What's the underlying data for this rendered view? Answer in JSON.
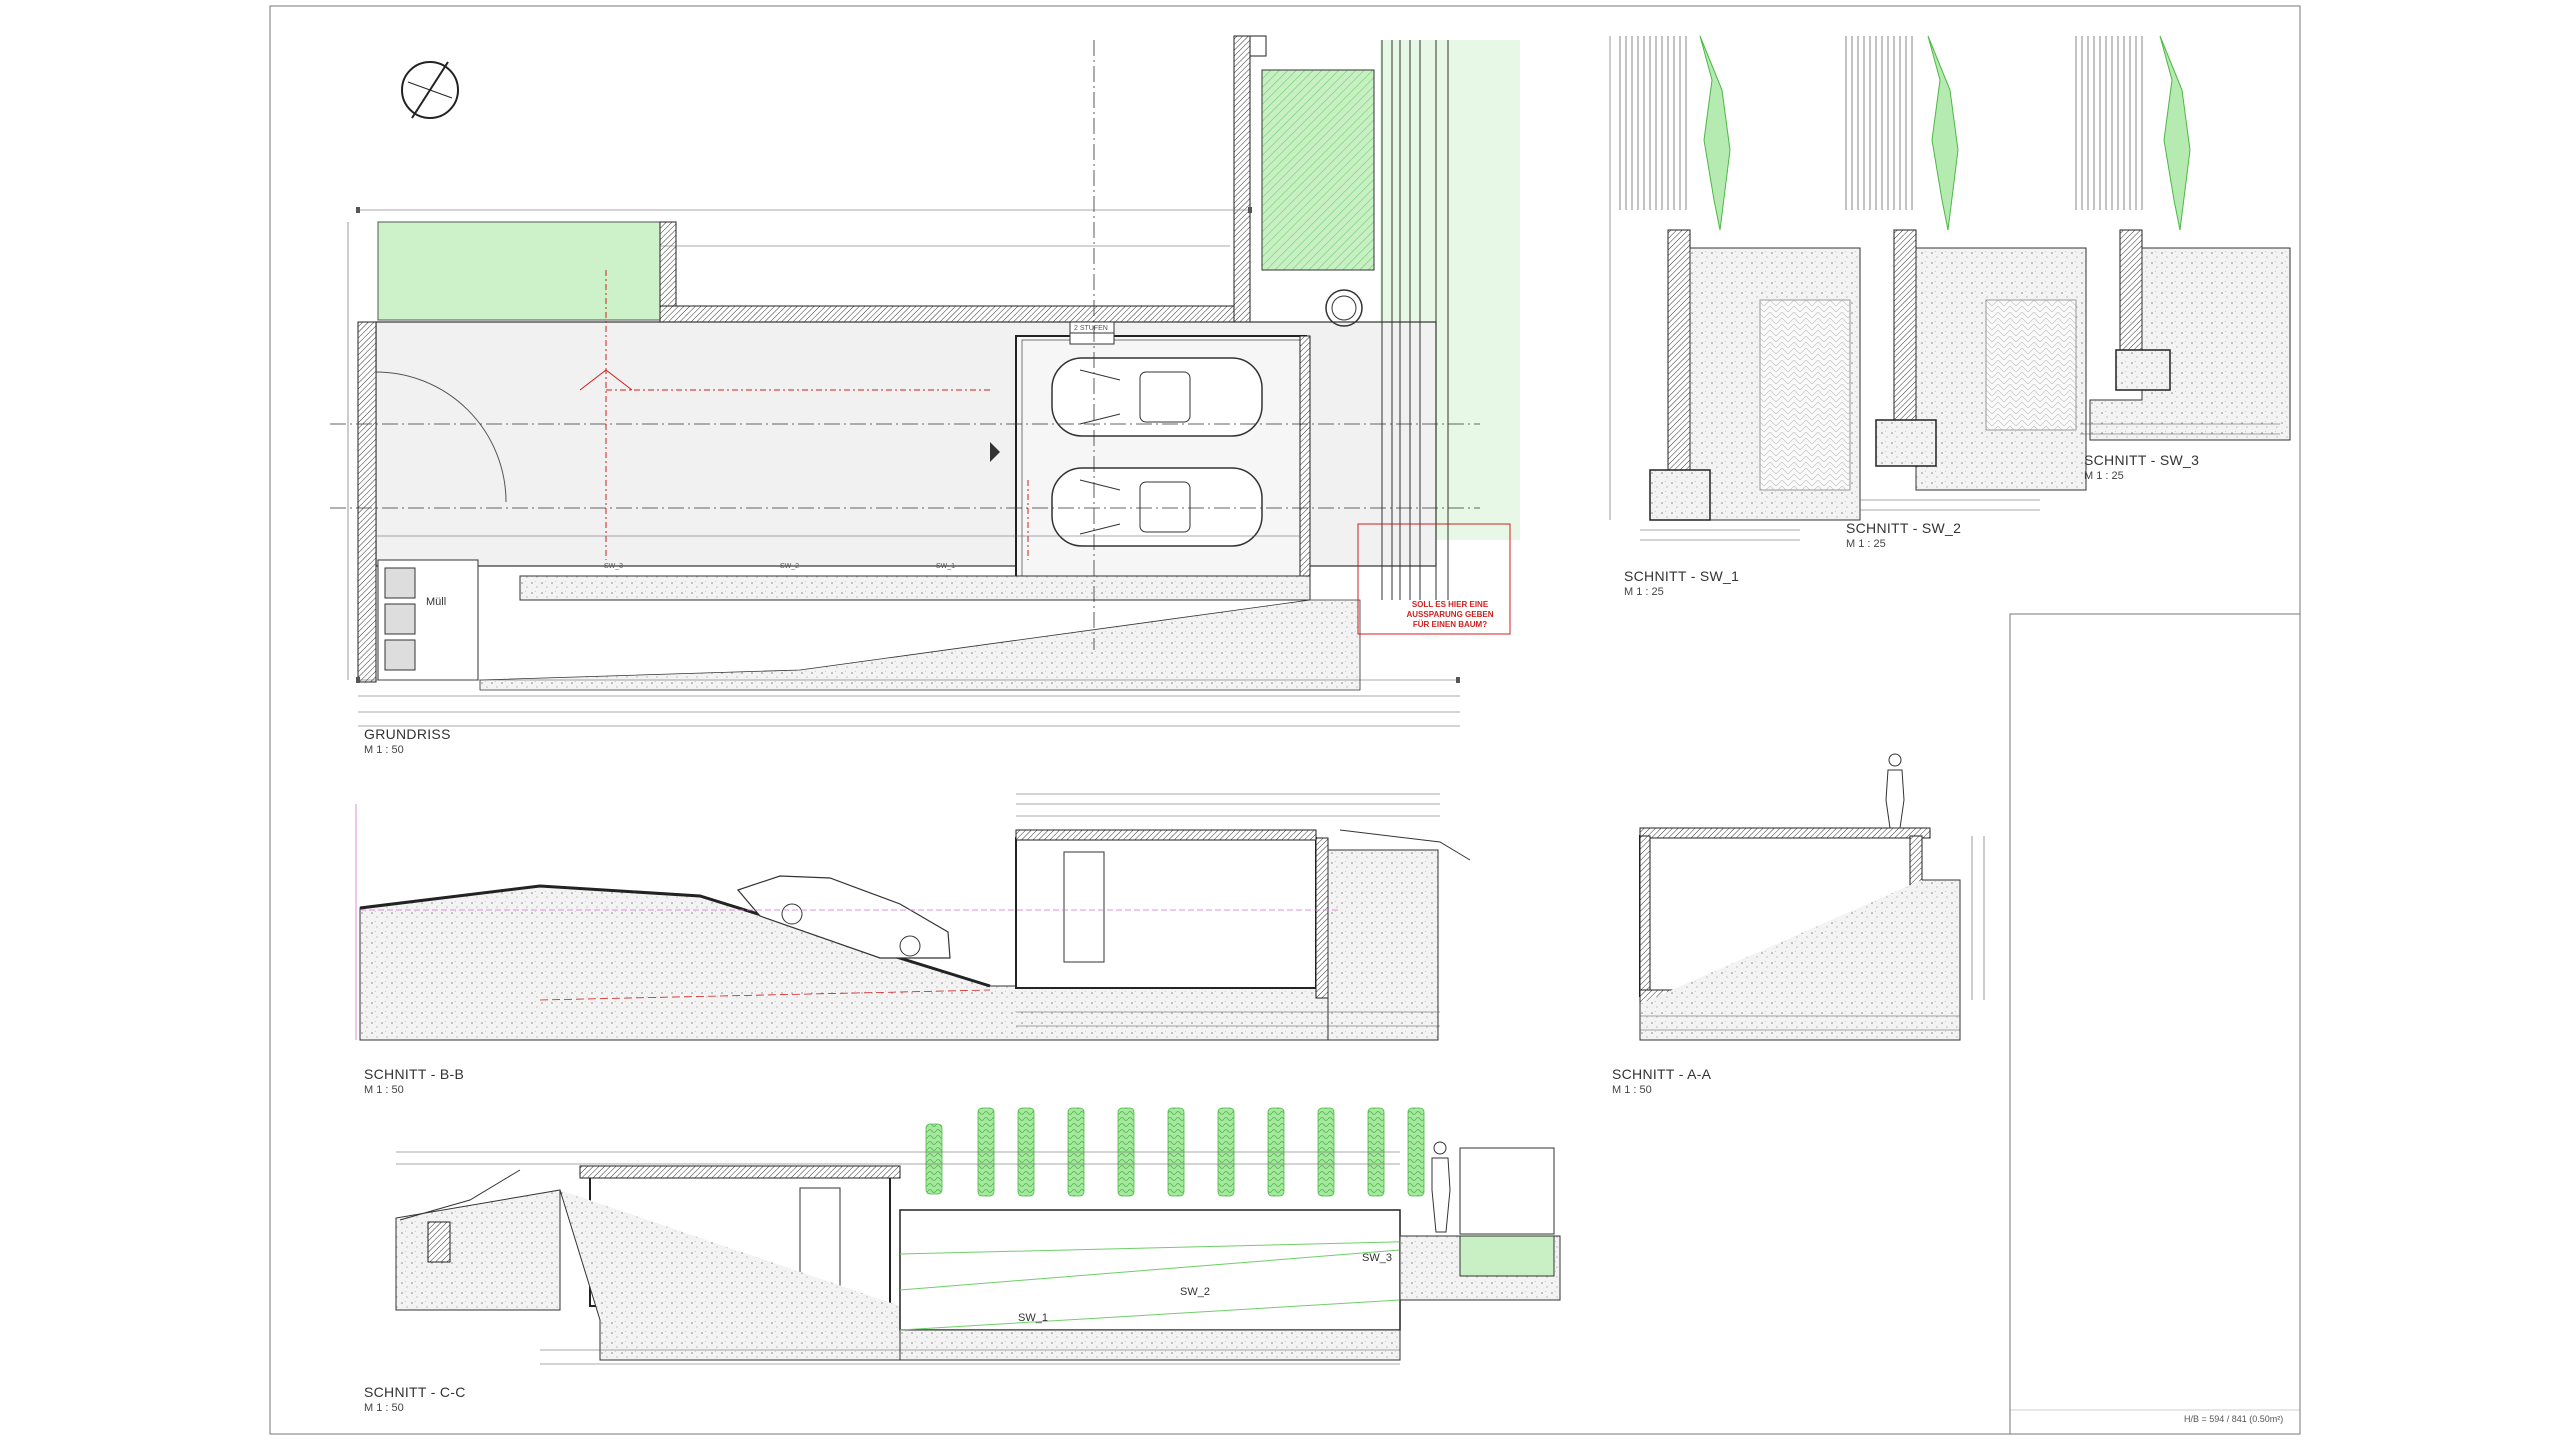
{
  "sections": {
    "grundriss": {
      "title": "GRUNDRISS",
      "scale": "M 1 : 50"
    },
    "schnitt_bb": {
      "title": "SCHNITT - B-B",
      "scale": "M 1 : 50"
    },
    "schnitt_aa": {
      "title": "SCHNITT - A-A",
      "scale": "M 1 : 50"
    },
    "schnitt_cc": {
      "title": "SCHNITT - C-C",
      "scale": "M 1 : 50"
    },
    "schnitt_sw1": {
      "title": "SCHNITT - SW_1",
      "scale": "M 1 : 25"
    },
    "schnitt_sw2": {
      "title": "SCHNITT - SW_2",
      "scale": "M 1 : 25"
    },
    "schnitt_sw3": {
      "title": "SCHNITT - SW_3",
      "scale": "M 1 : 25"
    }
  },
  "plan_labels": {
    "muell": "Müll",
    "stufen": "2 STUFEN",
    "note_red": "SOLL ES HIER EINE AUSSPARUNG GEBEN FÜR EINEN BAUM?",
    "sw1": "SW_1",
    "sw2": "SW_2",
    "sw3": "SW_3"
  },
  "cc_labels": {
    "sw1": "SW_1",
    "sw2": "SW_2",
    "sw3": "SW_3"
  },
  "footer": {
    "format": "H/B = 594 / 841 (0.50m²)"
  },
  "colors": {
    "hatch_green": "#9fe39a",
    "section_red": "#d02020",
    "line": "#333333"
  }
}
